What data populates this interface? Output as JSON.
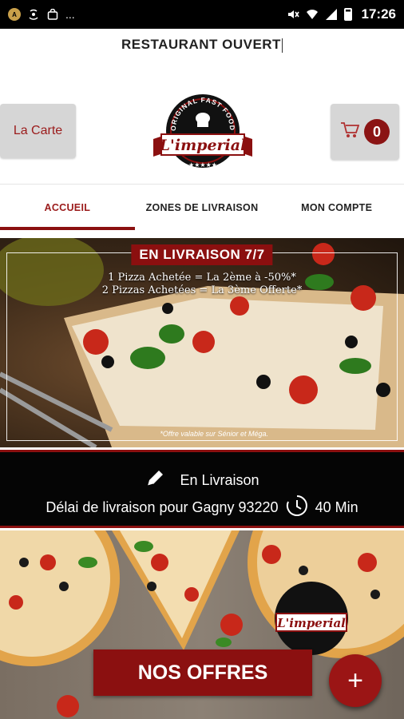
{
  "status_bar": {
    "time": "17:26",
    "left_icons": [
      "auto-brightness-icon",
      "hotspot-icon",
      "shopping-bag-icon",
      "more-icon"
    ],
    "more_label": "...",
    "right_icons": [
      "mute-icon",
      "wifi-icon",
      "signal-icon",
      "battery-icon"
    ]
  },
  "header": {
    "open_status": "RESTAURANT OUVERT",
    "menu_button": "La Carte",
    "cart_count": "0",
    "logo": {
      "arc_text": "ORIGINAL FAST FOOD",
      "name": "L'imperial",
      "stars": "★★★★★"
    }
  },
  "tabs": [
    {
      "label": "ACCUEIL",
      "active": true
    },
    {
      "label": "ZONES DE LIVRAISON",
      "active": false
    },
    {
      "label": "MON COMPTE",
      "active": false
    }
  ],
  "promo": {
    "title": "EN LIVRAISON 7/7",
    "line1": "1 Pizza Achetée = La 2ème à -50%*",
    "line2": "2 Pizzas Achetées = La 3ème Offerte*",
    "note": "*Offre valable sur Sénior et Méga."
  },
  "delivery": {
    "mode": "En Livraison",
    "delay_label": "Délai de livraison pour Gagny 93220",
    "delay_value": "40 Min"
  },
  "offers_button": "NOS OFFRES",
  "fab_label": "+",
  "colors": {
    "brand_red": "#8b1010",
    "tab_active": "#9b1b1b",
    "button_gray": "#d6d6d6"
  }
}
